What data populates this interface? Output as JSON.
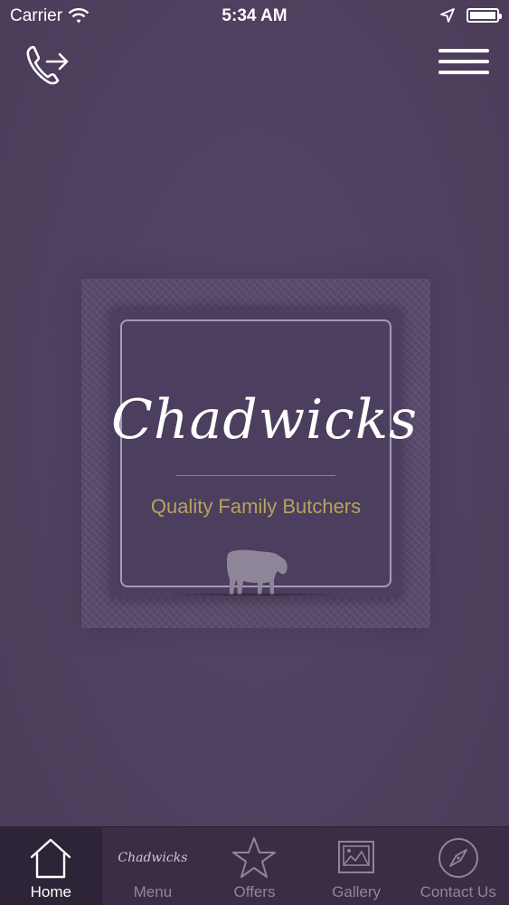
{
  "status_bar": {
    "carrier": "Carrier",
    "time": "5:34 AM",
    "icons": [
      "wifi-icon",
      "location-arrow-icon",
      "battery-icon"
    ]
  },
  "header": {
    "call_icon": "phone-arrow-icon",
    "menu_icon": "hamburger-menu-icon"
  },
  "logo": {
    "name": "Chadwicks",
    "tagline": "Quality Family Butchers",
    "graphic": "cow-icon"
  },
  "tabs": [
    {
      "label": "Home",
      "icon": "home-icon",
      "active": true
    },
    {
      "label": "Menu",
      "icon_text": "Chadwicks",
      "active": false
    },
    {
      "label": "Offers",
      "icon": "star-icon",
      "active": false
    },
    {
      "label": "Gallery",
      "icon": "gallery-icon",
      "active": false
    },
    {
      "label": "Contact Us",
      "icon": "compass-icon",
      "active": false
    }
  ],
  "colors": {
    "background": "#4f405f",
    "tab_bar": "#3a2e46",
    "tagline": "#b7a25d",
    "text": "#ffffff"
  }
}
